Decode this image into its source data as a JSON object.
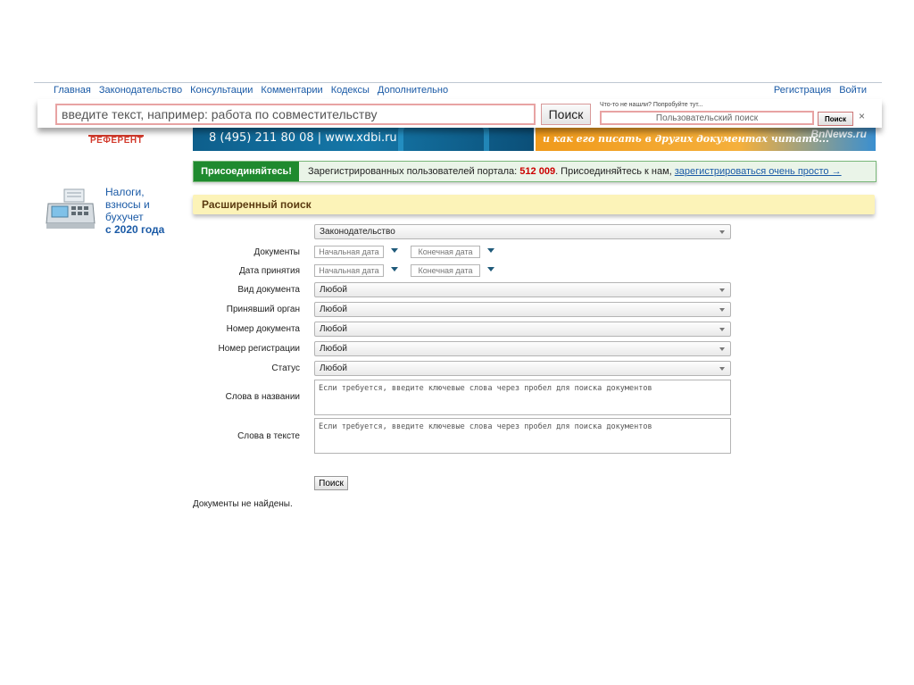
{
  "nav": {
    "items": [
      "Главная",
      "Законодательство",
      "Консультации",
      "Комментарии",
      "Кодексы",
      "Дополнительно"
    ],
    "register": "Регистрация",
    "login": "Войти"
  },
  "search": {
    "placeholder": "введите текст, например: работа по совместительству",
    "button": "Поиск",
    "hint": "Что-то не нашли? Попробуйте тут...",
    "user_placeholder": "Пользовательский поиск",
    "user_button": "Поиск",
    "close": "×"
  },
  "logo": {
    "text": "РЕФЕРЕНТ"
  },
  "banners": {
    "phone": "8 (495) 211 80 08 | www.xdbi.ru",
    "promo_text": "и как его писать в других документах",
    "promo_read": "читать...",
    "promo_brand": "BnNews.ru"
  },
  "join": {
    "badge": "Присоединяйтесь!",
    "text_before": "Зарегистрированных пользователей портала: ",
    "count": "512 009",
    "text_after": ". Присоединяйтесь к нам, ",
    "link": "зарегистрироваться очень просто →"
  },
  "promo": {
    "line1": "Налоги,",
    "line2": "взносы и",
    "line3": "бухучет",
    "line4": "с 2020 года"
  },
  "advanced": {
    "title": "Расширенный поиск",
    "section_select": "Законодательство",
    "labels": {
      "documents": "Документы",
      "adoption_date": "Дата принятия",
      "doc_type": "Вид документа",
      "authority": "Принявший орган",
      "doc_number": "Номер документа",
      "reg_number": "Номер регистрации",
      "status": "Статус",
      "title_words": "Слова в названии",
      "text_words": "Слова в тексте"
    },
    "start_date": "Начальная дата",
    "end_date": "Конечная дата",
    "any": "Любой",
    "kw_placeholder": "Если требуется, введите ключевые слова через пробел для поиска документов",
    "submit": "Поиск",
    "result": "Документы не найдены."
  }
}
